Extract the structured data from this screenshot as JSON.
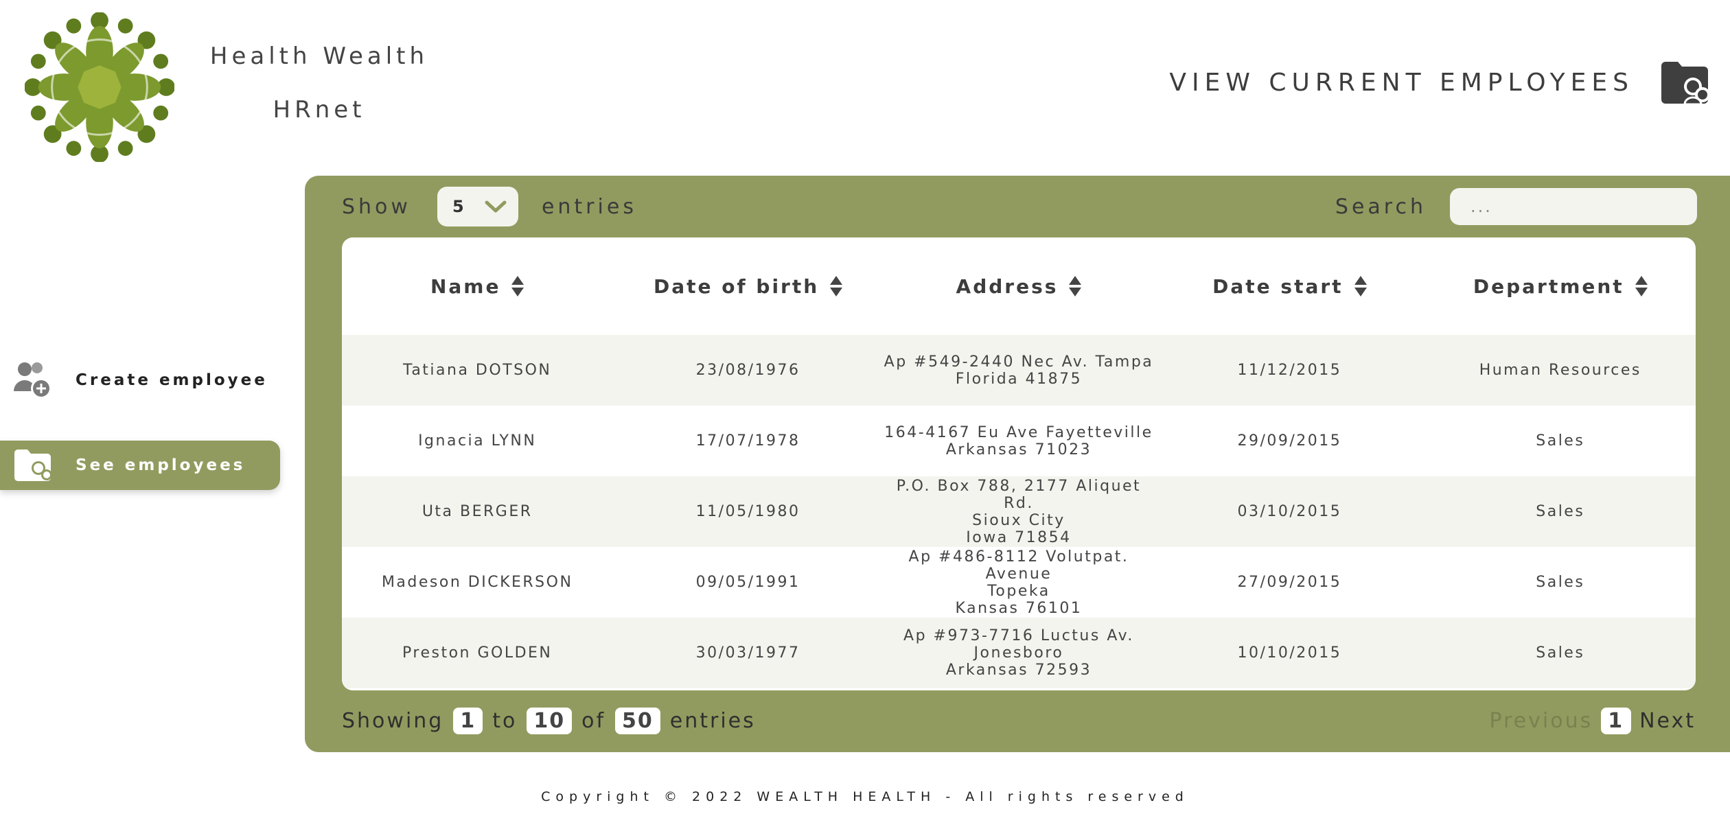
{
  "brand": {
    "line1": "Health Wealth",
    "line2": "HRnet"
  },
  "page_title": "VIEW CURRENT EMPLOYEES",
  "sidebar": {
    "items": [
      {
        "label": "Create employee",
        "icon": "user-add-icon",
        "active": false
      },
      {
        "label": "See employees",
        "icon": "folder-users-icon",
        "active": true
      }
    ]
  },
  "controls": {
    "show_label": "Show",
    "entries_value": "5",
    "entries_label": "entries",
    "search_label": "Search",
    "search_placeholder": "..."
  },
  "table": {
    "columns": [
      "Name",
      "Date of birth",
      "Address",
      "Date start",
      "Department"
    ],
    "rows": [
      {
        "name": "Tatiana DOTSON",
        "dob": "23/08/1976",
        "address": [
          "Ap #549-2440 Nec Av. Tampa",
          "Florida 41875"
        ],
        "start": "11/12/2015",
        "department": "Human Resources"
      },
      {
        "name": "Ignacia LYNN",
        "dob": "17/07/1978",
        "address": [
          "164-4167 Eu Ave Fayetteville",
          "Arkansas 71023"
        ],
        "start": "29/09/2015",
        "department": "Sales"
      },
      {
        "name": "Uta BERGER",
        "dob": "11/05/1980",
        "address": [
          "P.O. Box 788, 2177 Aliquet Rd.",
          "Sioux City",
          "Iowa 71854"
        ],
        "start": "03/10/2015",
        "department": "Sales"
      },
      {
        "name": "Madeson DICKERSON",
        "dob": "09/05/1991",
        "address": [
          "Ap #486-8112 Volutpat. Avenue",
          "Topeka",
          "Kansas 76101"
        ],
        "start": "27/09/2015",
        "department": "Sales"
      },
      {
        "name": "Preston GOLDEN",
        "dob": "30/03/1977",
        "address": [
          "Ap #973-7716 Luctus Av.",
          "Jonesboro",
          "Arkansas 72593"
        ],
        "start": "10/10/2015",
        "department": "Sales"
      }
    ]
  },
  "info": {
    "showing": "Showing",
    "from": "1",
    "to_label": "to",
    "to": "10",
    "of_label": "of",
    "total": "50",
    "entries": "entries"
  },
  "pagination": {
    "previous": "Previous",
    "current": "1",
    "next": "Next"
  },
  "footer": "Copyright © 2022 WEALTH HEALTH - All rights reserved",
  "colors": {
    "accent": "#919b5f",
    "logo_green": "#6e8a2a",
    "row_alt": "#f4f4ef"
  }
}
